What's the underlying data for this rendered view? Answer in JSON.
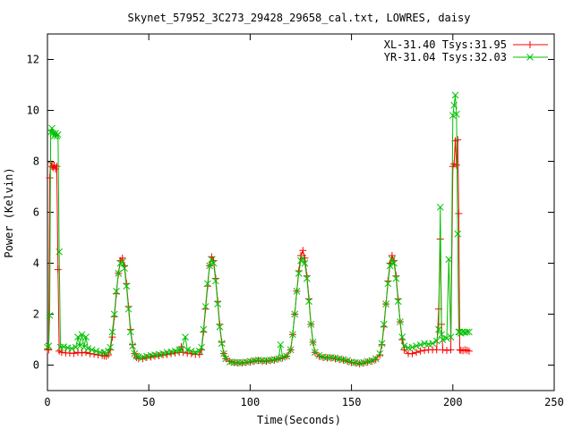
{
  "chart_data": {
    "type": "scatter",
    "title": "Skynet_57952_3C273_29428_29658_cal.txt, LOWRES, daisy",
    "xlabel": "Time(Seconds)",
    "ylabel": "Power (Kelvin)",
    "xlim": [
      0,
      250
    ],
    "ylim": [
      -1,
      13
    ],
    "xticks": [
      0,
      50,
      100,
      150,
      200,
      250
    ],
    "yticks": [
      0,
      2,
      4,
      6,
      8,
      10,
      12
    ],
    "grid": false,
    "legend_position": "top-right",
    "series": [
      {
        "name": "XL-31.40 Tsys:31.95",
        "color": "#ff0000",
        "marker": "plus",
        "points": [
          [
            0,
            0.62
          ],
          [
            0.6,
            0.6
          ],
          [
            1.1,
            7.35
          ],
          [
            1.6,
            7.95
          ],
          [
            2.2,
            7.8
          ],
          [
            2.8,
            7.75
          ],
          [
            3.4,
            7.85
          ],
          [
            4.0,
            7.7
          ],
          [
            4.6,
            7.8
          ],
          [
            5.2,
            3.75
          ],
          [
            5.8,
            0.55
          ],
          [
            7,
            0.5
          ],
          [
            9,
            0.48
          ],
          [
            11,
            0.47
          ],
          [
            13,
            0.46
          ],
          [
            15,
            0.5
          ],
          [
            17,
            0.48
          ],
          [
            19,
            0.5
          ],
          [
            21,
            0.45
          ],
          [
            23,
            0.43
          ],
          [
            25,
            0.4
          ],
          [
            27,
            0.38
          ],
          [
            28,
            0.36
          ],
          [
            29,
            0.35
          ],
          [
            30,
            0.4
          ],
          [
            31,
            0.6
          ],
          [
            32,
            1.1
          ],
          [
            33,
            1.9
          ],
          [
            34,
            2.8
          ],
          [
            35,
            3.6
          ],
          [
            36,
            4.1
          ],
          [
            37,
            4.2
          ],
          [
            38,
            3.9
          ],
          [
            39,
            3.2
          ],
          [
            40,
            2.3
          ],
          [
            41,
            1.4
          ],
          [
            42,
            0.8
          ],
          [
            43,
            0.45
          ],
          [
            44,
            0.3
          ],
          [
            45,
            0.25
          ],
          [
            47,
            0.25
          ],
          [
            49,
            0.3
          ],
          [
            51,
            0.32
          ],
          [
            53,
            0.35
          ],
          [
            55,
            0.37
          ],
          [
            57,
            0.4
          ],
          [
            59,
            0.42
          ],
          [
            61,
            0.45
          ],
          [
            63,
            0.48
          ],
          [
            65,
            0.5
          ],
          [
            66,
            0.72
          ],
          [
            67,
            0.5
          ],
          [
            69,
            0.47
          ],
          [
            71,
            0.45
          ],
          [
            73,
            0.42
          ],
          [
            75,
            0.42
          ],
          [
            76,
            0.6
          ],
          [
            77,
            1.3
          ],
          [
            78,
            2.2
          ],
          [
            79,
            3.1
          ],
          [
            80,
            3.9
          ],
          [
            81,
            4.25
          ],
          [
            82,
            4.1
          ],
          [
            83,
            3.4
          ],
          [
            84,
            2.5
          ],
          [
            85,
            1.6
          ],
          [
            86,
            0.9
          ],
          [
            87,
            0.45
          ],
          [
            88,
            0.25
          ],
          [
            90,
            0.15
          ],
          [
            92,
            0.1
          ],
          [
            94,
            0.08
          ],
          [
            96,
            0.08
          ],
          [
            98,
            0.1
          ],
          [
            100,
            0.12
          ],
          [
            102,
            0.15
          ],
          [
            104,
            0.18
          ],
          [
            106,
            0.15
          ],
          [
            108,
            0.15
          ],
          [
            110,
            0.18
          ],
          [
            112,
            0.2
          ],
          [
            114,
            0.25
          ],
          [
            116,
            0.28
          ],
          [
            118,
            0.35
          ],
          [
            120,
            0.6
          ],
          [
            121,
            1.2
          ],
          [
            122,
            2.0
          ],
          [
            123,
            2.9
          ],
          [
            124,
            3.7
          ],
          [
            125,
            4.3
          ],
          [
            126,
            4.5
          ],
          [
            127,
            4.2
          ],
          [
            128,
            3.5
          ],
          [
            129,
            2.6
          ],
          [
            130,
            1.6
          ],
          [
            131,
            0.9
          ],
          [
            132,
            0.5
          ],
          [
            134,
            0.35
          ],
          [
            136,
            0.3
          ],
          [
            138,
            0.28
          ],
          [
            140,
            0.28
          ],
          [
            142,
            0.25
          ],
          [
            144,
            0.22
          ],
          [
            146,
            0.2
          ],
          [
            148,
            0.15
          ],
          [
            150,
            0.1
          ],
          [
            152,
            0.08
          ],
          [
            154,
            0.05
          ],
          [
            156,
            0.08
          ],
          [
            158,
            0.12
          ],
          [
            160,
            0.15
          ],
          [
            162,
            0.22
          ],
          [
            164,
            0.4
          ],
          [
            165,
            0.8
          ],
          [
            166,
            1.5
          ],
          [
            167,
            2.4
          ],
          [
            168,
            3.3
          ],
          [
            169,
            4.0
          ],
          [
            170,
            4.3
          ],
          [
            171,
            4.1
          ],
          [
            172,
            3.5
          ],
          [
            173,
            2.6
          ],
          [
            174,
            1.7
          ],
          [
            175,
            1.0
          ],
          [
            176,
            0.6
          ],
          [
            178,
            0.45
          ],
          [
            180,
            0.45
          ],
          [
            182,
            0.5
          ],
          [
            184,
            0.55
          ],
          [
            186,
            0.58
          ],
          [
            188,
            0.6
          ],
          [
            190,
            0.6
          ],
          [
            192,
            0.6
          ],
          [
            193,
            2.2
          ],
          [
            193.8,
            4.95
          ],
          [
            194.4,
            1.6
          ],
          [
            195,
            0.6
          ],
          [
            197,
            0.58
          ],
          [
            199,
            0.6
          ],
          [
            200,
            7.8
          ],
          [
            200.6,
            7.9
          ],
          [
            201.2,
            8.8
          ],
          [
            201.8,
            7.85
          ],
          [
            202.4,
            8.85
          ],
          [
            202.9,
            5.95
          ],
          [
            203.4,
            0.6
          ],
          [
            204,
            0.58
          ],
          [
            205,
            0.57
          ],
          [
            206,
            0.6
          ],
          [
            207,
            0.58
          ],
          [
            208,
            0.55
          ]
        ]
      },
      {
        "name": "YR-31.04 Tsys:32.03",
        "color": "#00c000",
        "marker": "cross",
        "points": [
          [
            0,
            0.7
          ],
          [
            0.6,
            0.75
          ],
          [
            1.1,
            1.95
          ],
          [
            1.6,
            9.15
          ],
          [
            2.2,
            9.3
          ],
          [
            2.8,
            9.1
          ],
          [
            3.4,
            9.0
          ],
          [
            4.0,
            9.1
          ],
          [
            4.6,
            9.0
          ],
          [
            5.2,
            9.05
          ],
          [
            5.8,
            4.45
          ],
          [
            6.4,
            0.7
          ],
          [
            8,
            0.72
          ],
          [
            10,
            0.68
          ],
          [
            12,
            0.65
          ],
          [
            14,
            0.7
          ],
          [
            15,
            1.1
          ],
          [
            16,
            0.75
          ],
          [
            17,
            1.2
          ],
          [
            18,
            0.7
          ],
          [
            19,
            1.1
          ],
          [
            20,
            0.65
          ],
          [
            22,
            0.6
          ],
          [
            24,
            0.55
          ],
          [
            26,
            0.5
          ],
          [
            28,
            0.5
          ],
          [
            29,
            0.45
          ],
          [
            30,
            0.55
          ],
          [
            31,
            0.7
          ],
          [
            32,
            1.3
          ],
          [
            33,
            2.0
          ],
          [
            34,
            2.9
          ],
          [
            35,
            3.6
          ],
          [
            36,
            4.0
          ],
          [
            37,
            4.05
          ],
          [
            38,
            3.8
          ],
          [
            39,
            3.1
          ],
          [
            40,
            2.2
          ],
          [
            41,
            1.3
          ],
          [
            42,
            0.75
          ],
          [
            43,
            0.45
          ],
          [
            44,
            0.35
          ],
          [
            45,
            0.32
          ],
          [
            47,
            0.3
          ],
          [
            49,
            0.35
          ],
          [
            51,
            0.38
          ],
          [
            53,
            0.4
          ],
          [
            55,
            0.42
          ],
          [
            57,
            0.45
          ],
          [
            59,
            0.5
          ],
          [
            61,
            0.52
          ],
          [
            63,
            0.55
          ],
          [
            65,
            0.6
          ],
          [
            66,
            0.6
          ],
          [
            68,
            1.1
          ],
          [
            69,
            0.6
          ],
          [
            71,
            0.55
          ],
          [
            73,
            0.5
          ],
          [
            75,
            0.55
          ],
          [
            76,
            0.7
          ],
          [
            77,
            1.4
          ],
          [
            78,
            2.3
          ],
          [
            79,
            3.2
          ],
          [
            80,
            3.9
          ],
          [
            81,
            4.15
          ],
          [
            82,
            4.0
          ],
          [
            83,
            3.3
          ],
          [
            84,
            2.4
          ],
          [
            85,
            1.5
          ],
          [
            86,
            0.85
          ],
          [
            87,
            0.45
          ],
          [
            88,
            0.25
          ],
          [
            90,
            0.12
          ],
          [
            92,
            0.1
          ],
          [
            94,
            0.1
          ],
          [
            96,
            0.1
          ],
          [
            98,
            0.12
          ],
          [
            100,
            0.15
          ],
          [
            102,
            0.18
          ],
          [
            104,
            0.2
          ],
          [
            106,
            0.18
          ],
          [
            108,
            0.18
          ],
          [
            110,
            0.2
          ],
          [
            112,
            0.22
          ],
          [
            114,
            0.25
          ],
          [
            115,
            0.8
          ],
          [
            116,
            0.3
          ],
          [
            118,
            0.35
          ],
          [
            120,
            0.6
          ],
          [
            121,
            1.2
          ],
          [
            122,
            2.0
          ],
          [
            123,
            2.9
          ],
          [
            124,
            3.6
          ],
          [
            125,
            4.1
          ],
          [
            126,
            4.2
          ],
          [
            127,
            4.0
          ],
          [
            128,
            3.4
          ],
          [
            129,
            2.5
          ],
          [
            130,
            1.6
          ],
          [
            131,
            0.9
          ],
          [
            132,
            0.5
          ],
          [
            134,
            0.38
          ],
          [
            136,
            0.32
          ],
          [
            138,
            0.3
          ],
          [
            140,
            0.3
          ],
          [
            142,
            0.28
          ],
          [
            144,
            0.25
          ],
          [
            146,
            0.22
          ],
          [
            148,
            0.18
          ],
          [
            150,
            0.12
          ],
          [
            152,
            0.1
          ],
          [
            154,
            0.08
          ],
          [
            156,
            0.1
          ],
          [
            158,
            0.15
          ],
          [
            160,
            0.18
          ],
          [
            162,
            0.25
          ],
          [
            164,
            0.45
          ],
          [
            165,
            0.85
          ],
          [
            166,
            1.6
          ],
          [
            167,
            2.4
          ],
          [
            168,
            3.2
          ],
          [
            169,
            3.9
          ],
          [
            170,
            4.15
          ],
          [
            171,
            4.0
          ],
          [
            172,
            3.4
          ],
          [
            173,
            2.5
          ],
          [
            174,
            1.7
          ],
          [
            175,
            1.1
          ],
          [
            176,
            0.75
          ],
          [
            178,
            0.68
          ],
          [
            180,
            0.7
          ],
          [
            182,
            0.75
          ],
          [
            184,
            0.8
          ],
          [
            186,
            0.85
          ],
          [
            188,
            0.82
          ],
          [
            190,
            0.85
          ],
          [
            192,
            0.95
          ],
          [
            193,
            1.4
          ],
          [
            193.8,
            6.2
          ],
          [
            194.4,
            1.2
          ],
          [
            195,
            1.0
          ],
          [
            197,
            1.05
          ],
          [
            198,
            4.15
          ],
          [
            199,
            1.1
          ],
          [
            200,
            9.8
          ],
          [
            200.6,
            10.2
          ],
          [
            201.2,
            10.6
          ],
          [
            201.8,
            9.85
          ],
          [
            202.4,
            5.15
          ],
          [
            202.9,
            1.3
          ],
          [
            203.4,
            1.3
          ],
          [
            204,
            1.25
          ],
          [
            205,
            1.3
          ],
          [
            206,
            1.28
          ],
          [
            207,
            1.3
          ],
          [
            208,
            1.3
          ]
        ]
      }
    ]
  }
}
